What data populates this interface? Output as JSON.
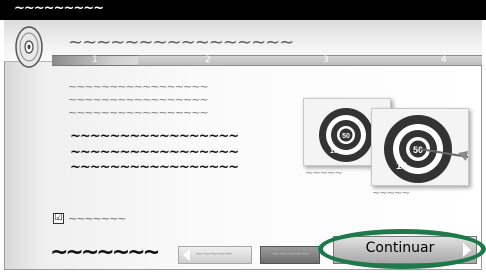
{
  "window": {
    "title": "~~~~~~~~~"
  },
  "header": {
    "title": "~~~~~~~~~~~~~~~~"
  },
  "steps": [
    {
      "label": "1",
      "active": true
    },
    {
      "label": "2",
      "active": false
    },
    {
      "label": "3",
      "active": false
    },
    {
      "label": "4",
      "active": false
    }
  ],
  "content": {
    "intro_lines": [
      "~~~~~~~~~~~~~~~~~",
      "~~~~~~~~~~~~~~~~~",
      "~~~~~~~~~~~~~~~~~"
    ],
    "bold_lines": [
      "~~~~~~~~~~~~~~~~~",
      "~~~~~~~~~~~~~~~~~",
      "~~~~~~~~~~~~~~~~~"
    ]
  },
  "pictures": [
    {
      "caption": "~~~~~",
      "target_labels": [
        "50",
        "10"
      ]
    },
    {
      "caption": "~~~~~",
      "target_labels": [
        "50",
        "10"
      ]
    }
  ],
  "checkbox": {
    "checked": true,
    "mark": "☑",
    "label": "~~~~~~~"
  },
  "footer": {
    "logo_text": "~~~~~~~"
  },
  "buttons": {
    "back": "~~~~~",
    "cancel": "~~~~~",
    "continue": "Continuar"
  },
  "colors": {
    "highlight": "#1e7a4a",
    "titlebar": "#000000"
  }
}
